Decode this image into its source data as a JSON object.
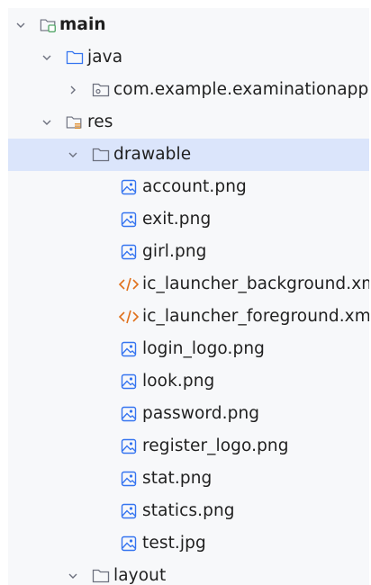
{
  "tree": {
    "main": {
      "label": "main"
    },
    "java": {
      "label": "java"
    },
    "package": {
      "label": "com.example.examinationapp"
    },
    "res": {
      "label": "res"
    },
    "drawable": {
      "label": "drawable"
    },
    "files": [
      {
        "label": "account.png",
        "icon": "image-file-icon"
      },
      {
        "label": "exit.png",
        "icon": "image-file-icon"
      },
      {
        "label": "girl.png",
        "icon": "image-file-icon"
      },
      {
        "label": "ic_launcher_background.xml",
        "icon": "xml-file-icon"
      },
      {
        "label": "ic_launcher_foreground.xml",
        "icon": "xml-file-icon"
      },
      {
        "label": "login_logo.png",
        "icon": "image-file-icon"
      },
      {
        "label": "look.png",
        "icon": "image-file-icon"
      },
      {
        "label": "password.png",
        "icon": "image-file-icon"
      },
      {
        "label": "register_logo.png",
        "icon": "image-file-icon"
      },
      {
        "label": "stat.png",
        "icon": "image-file-icon"
      },
      {
        "label": "statics.png",
        "icon": "image-file-icon"
      },
      {
        "label": "test.jpg",
        "icon": "image-file-icon"
      }
    ],
    "layout": {
      "label": "layout"
    }
  },
  "colors": {
    "selection": "#dbe5fb",
    "folder_blue": "#3574f0",
    "folder_gray": "#6c707e",
    "module_green": "#55a76a",
    "res_orange": "#e08d2a",
    "xml_orange": "#e0701b"
  }
}
